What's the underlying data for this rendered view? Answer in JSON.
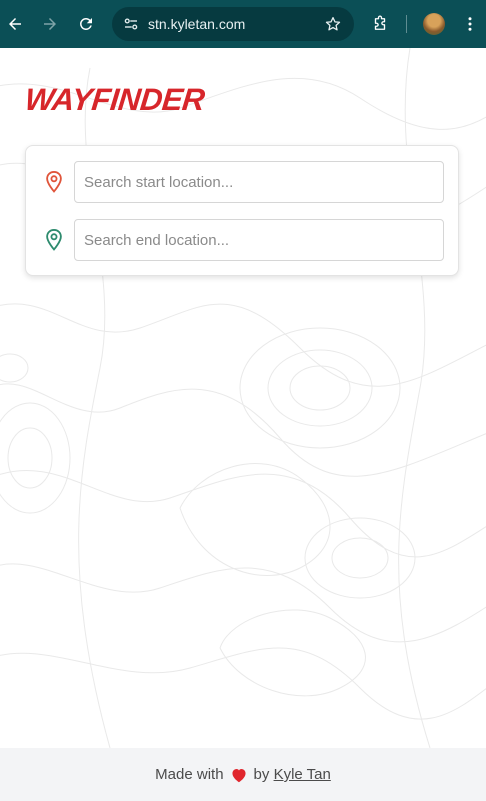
{
  "browser": {
    "url": "stn.kyletan.com",
    "icons": [
      "back-icon",
      "forward-icon",
      "reload-icon",
      "site-settings-icon",
      "bookmark-star-icon",
      "extensions-icon",
      "profile-avatar",
      "more-menu-icon"
    ]
  },
  "app": {
    "logo": "WAYFINDER",
    "accent_color": "#d7262b"
  },
  "search": {
    "start": {
      "placeholder": "Search start location...",
      "value": "",
      "icon": "pin-start-icon",
      "color": "#e0553b"
    },
    "end": {
      "placeholder": "Search end location...",
      "value": "",
      "icon": "pin-end-icon",
      "color": "#2e8b6e"
    }
  },
  "footer": {
    "prefix": "Made with",
    "between": "by",
    "author": "Kyle Tan",
    "icon": "heart-icon"
  }
}
